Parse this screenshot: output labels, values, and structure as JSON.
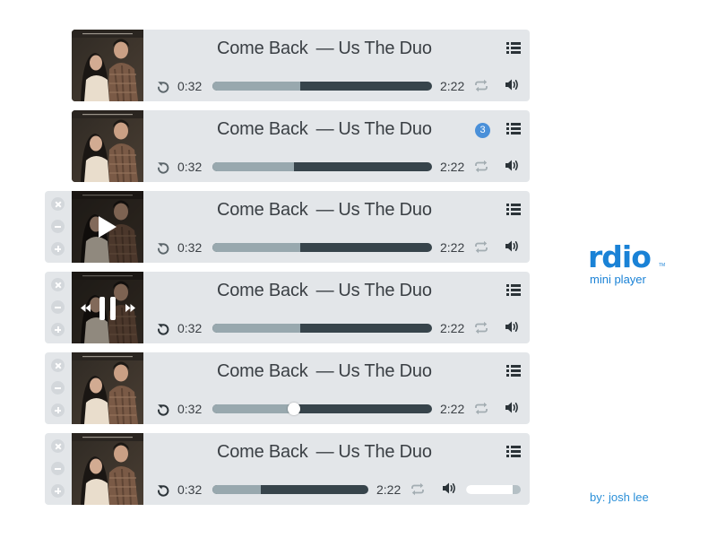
{
  "brand": {
    "logo": "rdio",
    "subtitle": "mini player",
    "byline": "by: josh lee"
  },
  "colors": {
    "accent": "#1a82d6",
    "badge": "#4a90d9",
    "track": "#37444b",
    "track_fill": "#98a8ae",
    "panel": "#e3e6e9"
  },
  "icons": [
    "replay-icon",
    "repeat-icon",
    "volume-icon",
    "queue-list-icon",
    "play-icon",
    "pause-icon",
    "rewind-icon",
    "fast-forward-icon",
    "close-icon",
    "minimize-icon",
    "maximize-icon"
  ],
  "players": [
    {
      "title": "Come Back",
      "dash": "—",
      "artist": "Us The Duo",
      "current": "0:32",
      "total": "2:22",
      "progress": 0.4,
      "variant": "default"
    },
    {
      "title": "Come Back",
      "dash": "—",
      "artist": "Us The Duo",
      "current": "0:32",
      "total": "2:22",
      "progress": 0.37,
      "variant": "badge",
      "badge": "3"
    },
    {
      "title": "Come Back",
      "dash": "—",
      "artist": "Us The Duo",
      "current": "0:32",
      "total": "2:22",
      "progress": 0.4,
      "variant": "play-hover"
    },
    {
      "title": "Come Back",
      "dash": "—",
      "artist": "Us The Duo",
      "current": "0:32",
      "total": "2:22",
      "progress": 0.4,
      "variant": "pause-hover"
    },
    {
      "title": "Come Back",
      "dash": "—",
      "artist": "Us The Duo",
      "current": "0:32",
      "total": "2:22",
      "progress": 0.37,
      "variant": "scrubbing"
    },
    {
      "title": "Come Back",
      "dash": "—",
      "artist": "Us The Duo",
      "current": "0:32",
      "total": "2:22",
      "progress": 0.31,
      "variant": "volume-open",
      "volume": 0.85
    }
  ]
}
